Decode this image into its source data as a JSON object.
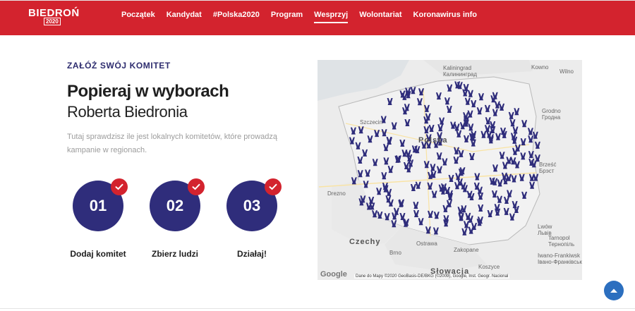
{
  "brand": {
    "name": "BIEDROŃ",
    "year": "2020"
  },
  "nav": {
    "items": [
      {
        "label": "Początek"
      },
      {
        "label": "Kandydat"
      },
      {
        "label": "#Polska2020"
      },
      {
        "label": "Program"
      },
      {
        "label": "Wesprzyj",
        "active": true
      },
      {
        "label": "Wolontariat"
      },
      {
        "label": "Koronawirus info"
      }
    ]
  },
  "hero": {
    "kicker": "ZAŁÓŻ SWÓJ KOMITET",
    "headline": "Popieraj w wyborach",
    "subheadline": "Roberta Biedronia",
    "description": "Tutaj sprawdzisz ile jest lokalnych komitetów, które prowadzą kampanie w regionach."
  },
  "steps": [
    {
      "number": "01",
      "label": "Dodaj komitet"
    },
    {
      "number": "02",
      "label": "Zbierz ludzi"
    },
    {
      "number": "03",
      "label": "Działaj!"
    }
  ],
  "map": {
    "labels": [
      {
        "text": "Kowno"
      },
      {
        "text": "Wilno"
      },
      {
        "text": "Kaliningrad"
      },
      {
        "text": "Калининград"
      },
      {
        "text": "Grodno"
      },
      {
        "text": "Гродна"
      },
      {
        "text": "Szczecin"
      },
      {
        "text": "Polska"
      },
      {
        "text": "Brześć"
      },
      {
        "text": "Брэст"
      },
      {
        "text": "Drezno"
      },
      {
        "text": "Czechy"
      },
      {
        "text": "Brno"
      },
      {
        "text": "Ostrawa"
      },
      {
        "text": "Zakopane"
      },
      {
        "text": "Słowacja"
      },
      {
        "text": "Koszyce"
      },
      {
        "text": "Lwów"
      },
      {
        "text": "Львів"
      },
      {
        "text": "Tarnopol"
      },
      {
        "text": "Тернопіль"
      },
      {
        "text": "Iwano-Frankiwsk"
      },
      {
        "text": "Івано-Франківськ"
      }
    ],
    "attribution": "Dane do Mapy ©2020 GeoBasis-DE/BKG (©2009), Google, Inst. Geogr. Nacional",
    "google": "Google",
    "marker_color": "#2f2d7b"
  },
  "colors": {
    "accent": "#d3232e",
    "primary": "#2f2d7b"
  },
  "icons": {
    "check": "check-icon",
    "scroll_top": "arrow-up-icon"
  }
}
